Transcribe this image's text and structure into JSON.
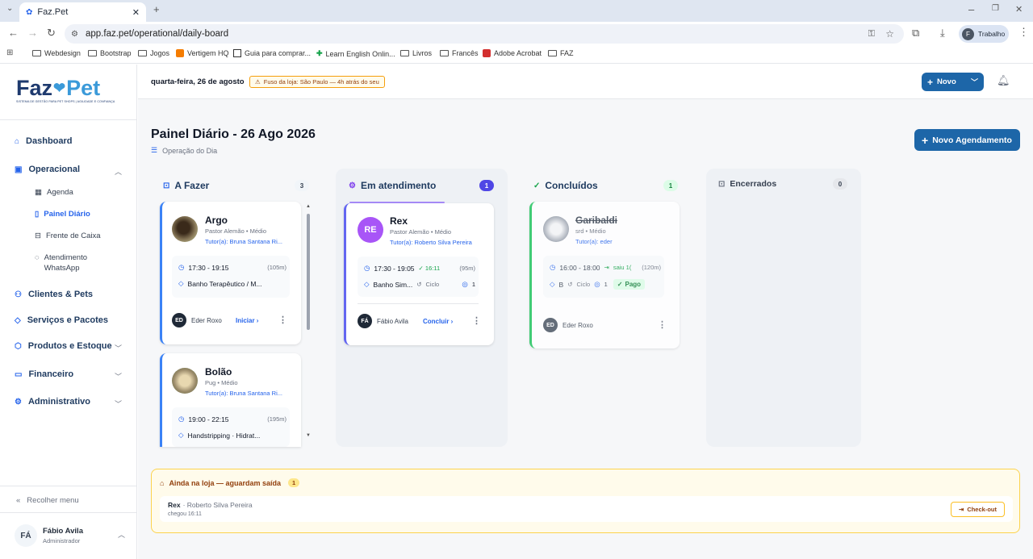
{
  "browser": {
    "tab_title": "Faz.Pet",
    "url": "app.faz.pet/operational/daily-board",
    "profile_label": "Trabalho",
    "profile_initial": "F",
    "bookmarks": [
      "Webdesign",
      "Bootstrap",
      "Jogos",
      "Vertigem HQ",
      "Guia para comprar...",
      "Learn English Onlin...",
      "Livros",
      "Francês",
      "Adobe Acrobat",
      "FAZ"
    ]
  },
  "sidebar": {
    "logo_text_left": "Faz",
    "logo_text_right": "Pet",
    "logo_tagline": "SISTEMA DE GESTÃO PARA PET SHOPS | AGILIDADE E CONFIANÇA",
    "dashboard": "Dashboard",
    "operacional": "Operacional",
    "sub": [
      "Agenda",
      "Painel Diário",
      "Frente de Caixa",
      "Atendimento WhatsApp"
    ],
    "clientes": "Clientes & Pets",
    "servicos": "Serviços e Pacotes",
    "produtos": "Produtos e Estoque",
    "financeiro": "Financeiro",
    "administrativo": "Administrativo",
    "collapse": "Recolher menu",
    "user_name": "Fábio Avila",
    "user_role": "Administrador",
    "user_initials": "FÁ"
  },
  "header": {
    "date": "quarta-feira, 26 de agosto",
    "tz_warning": "Fuso da loja: São Paulo — 4h atrás do seu",
    "new_button": "Novo"
  },
  "page": {
    "title": "Painel Diário - 26 Ago 2026",
    "subtitle": "Operação do Dia",
    "new_appointment": "Novo Agendamento"
  },
  "columns": {
    "todo": {
      "title": "A Fazer",
      "count": "3"
    },
    "inprogress": {
      "title": "Em atendimento",
      "count": "1"
    },
    "done": {
      "title": "Concluídos",
      "count": "1"
    },
    "closed": {
      "title": "Encerrados",
      "count": "0"
    }
  },
  "cards": {
    "argo": {
      "name": "Argo",
      "breed": "Pastor Alemão • Médio",
      "tutor": "Tutor(a): Bruna Santana Ri...",
      "time": "17:30 - 19:15",
      "duration": "(105m)",
      "service": "Banho Terapêutico / M...",
      "staff": "Eder Roxo",
      "staff_initials": "ED",
      "action": "Iniciar ›"
    },
    "bolao": {
      "name": "Bolão",
      "breed": "Pug • Médio",
      "tutor": "Tutor(a): Bruna Santana Ri...",
      "time": "19:00 - 22:15",
      "duration": "(195m)",
      "service": "Handstripping · Hidrat..."
    },
    "rex": {
      "name": "Rex",
      "initials": "RE",
      "breed": "Pastor Alemão • Médio",
      "tutor": "Tutor(a): Roberto Silva Pereira",
      "time": "17:30 - 19:05",
      "checkin": "✓ 16:11",
      "duration": "(95m)",
      "service": "Banho Sim...",
      "cycle": "Ciclo",
      "photos": "1",
      "staff": "Fábio Avila",
      "staff_initials": "FÁ",
      "action": "Concluir ›"
    },
    "garibaldi": {
      "name": "Garibaldi",
      "breed": "srd • Médio",
      "tutor": "Tutor(a): eder",
      "time": "16:00 - 18:00",
      "left": "saiu 1(",
      "duration": "(120m)",
      "service": "B",
      "cycle": "Ciclo",
      "photos": "1",
      "paid": "Pago",
      "staff": "Eder Roxo",
      "staff_initials": "ED"
    }
  },
  "waiting": {
    "title": "Ainda na loja — aguardam saída",
    "count": "1",
    "pet": "Rex",
    "owner": "· Roberto Silva Pereira",
    "arrived": "chegou 16:11",
    "checkout": "Check-out"
  }
}
